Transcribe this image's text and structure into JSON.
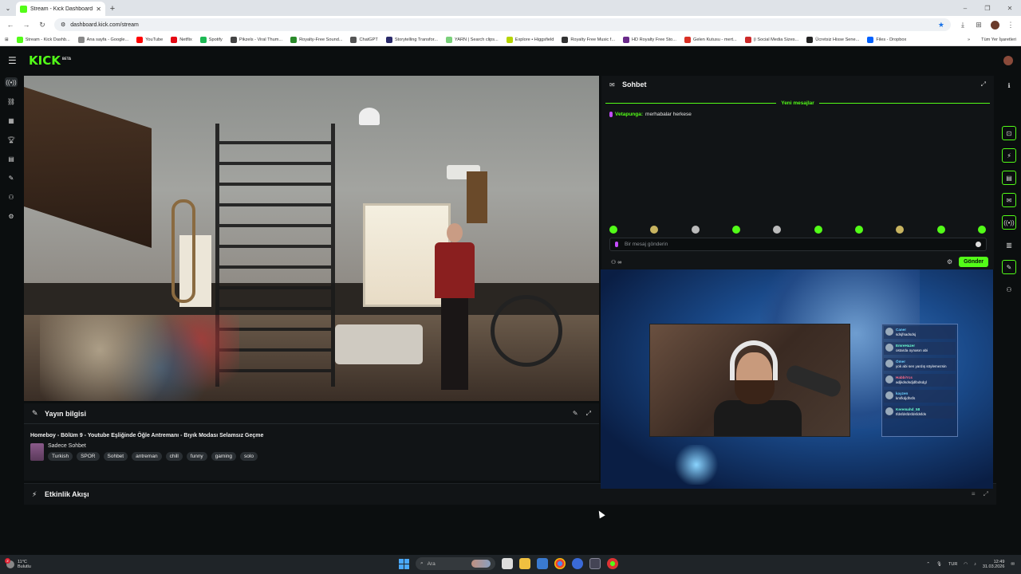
{
  "browser": {
    "tab_title": "Stream - Kick Dashboard",
    "url": "dashboard.kick.com/stream",
    "bookmarks": [
      {
        "label": "Stream - Kick Dashb...",
        "color": "#53fc18"
      },
      {
        "label": "Ana sayfa - Google...",
        "color": "#888888"
      },
      {
        "label": "YouTube",
        "color": "#ff0000"
      },
      {
        "label": "Netflix",
        "color": "#e50914"
      },
      {
        "label": "Spotify",
        "color": "#1db954"
      },
      {
        "label": "Pikzels - Viral Thum...",
        "color": "#444444"
      },
      {
        "label": "Royalty-Free Sound...",
        "color": "#2a8a2a"
      },
      {
        "label": "ChatGPT",
        "color": "#555555"
      },
      {
        "label": "Storytelling Transfor...",
        "color": "#2a2a6a"
      },
      {
        "label": "YARN | Search clips...",
        "color": "#7ad07a"
      },
      {
        "label": "Explore • Higgsfield",
        "color": "#b6d400"
      },
      {
        "label": "Royalty Free Music f...",
        "color": "#333333"
      },
      {
        "label": "HD Royalty Free Sto...",
        "color": "#6a2a8a"
      },
      {
        "label": "Gelen Kutusu - mert...",
        "color": "#d93025"
      },
      {
        "label": "(i Social Media Sizes...",
        "color": "#cc2a2a"
      },
      {
        "label": "Ücretsiz Hisse Sene...",
        "color": "#222222"
      },
      {
        "label": "Files - Dropbox",
        "color": "#0061ff"
      }
    ],
    "more": "»",
    "all_bookmarks": "Tüm Yer İşaretleri"
  },
  "app": {
    "logo": "KICK",
    "logo_sup": "BETA"
  },
  "stream_info": {
    "header": "Yayın bilgisi",
    "title": "Homeboy - Bölüm 9 - Youtube Eşliğinde Öğle Antremanı - Bıyık Modası Selamsız Geçme",
    "category": "Sadece Sohbet",
    "tags": [
      "Turkish",
      "SPOR",
      "Sohbet",
      "antreman",
      "chill",
      "funny",
      "gaming",
      "solo"
    ]
  },
  "activity": {
    "header": "Etkinlik Akışı"
  },
  "chat": {
    "header": "Sohbet",
    "new_messages": "Yeni mesajlar",
    "messages": [
      {
        "user": "Vetapunga:",
        "text": "merhabalar herkese"
      }
    ],
    "input_placeholder": "Bir mesaj gönderin",
    "send_label": "Gönder"
  },
  "preview_chat": [
    {
      "name": "Caner",
      "msg": "sdsjfsadsdsj",
      "style": ""
    },
    {
      "name": "EmreHazer",
      "msg": "ostarda oynasın abi",
      "style": "teal"
    },
    {
      "name": "Ömer",
      "msg": "yok abi sen yardış söylemezsin",
      "style": ""
    },
    {
      "name": "HabbiYcs",
      "msg": "adjkdsdsdjdlbdsdgl",
      "style": "red"
    },
    {
      "name": "kayzen",
      "msg": "kmfkdjdhsfs",
      "style": ""
    },
    {
      "name": "Keremahd_58",
      "msg": "Ifdsfdsfdsfdsfdsfds",
      "style": "teal"
    }
  ],
  "taskbar": {
    "weather_temp": "11°C",
    "weather_desc": "Bulutlu",
    "weather_badge": "2",
    "search_label": "Ara",
    "lang": "TUR",
    "time": "12:49",
    "date": "31.03.2026"
  }
}
